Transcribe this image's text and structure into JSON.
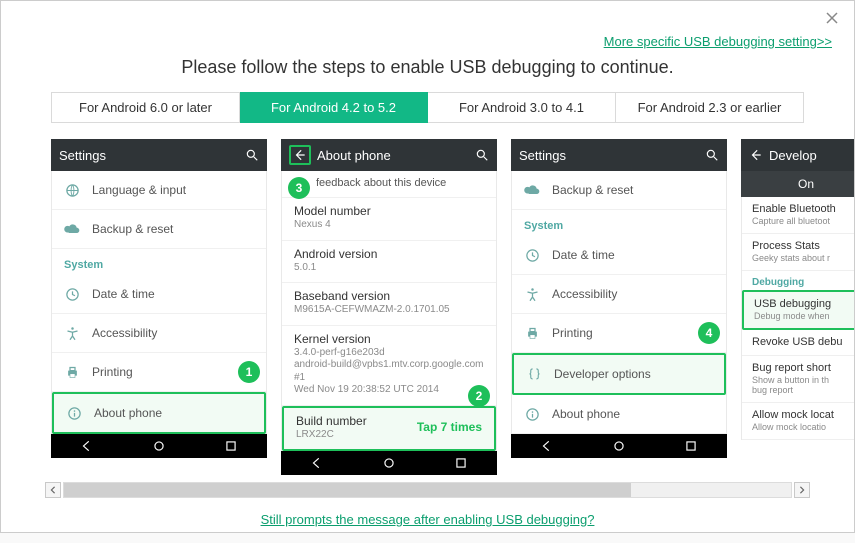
{
  "header": {
    "more_link": "More specific USB debugging setting>>",
    "title": "Please follow the steps to enable USB debugging to continue."
  },
  "tabs": [
    {
      "label": "For Android 6.0 or later",
      "active": false
    },
    {
      "label": "For Android 4.2 to 5.2",
      "active": true
    },
    {
      "label": "For Android 3.0 to 4.1",
      "active": false
    },
    {
      "label": "For Android 2.3 or earlier",
      "active": false
    }
  ],
  "shots": {
    "s1": {
      "appbar_title": "Settings",
      "rows": {
        "lang": "Language & input",
        "backup": "Backup & reset",
        "section": "System",
        "date": "Date & time",
        "access": "Accessibility",
        "print": "Printing",
        "about": "About phone"
      },
      "badge": "1"
    },
    "s2": {
      "appbar_title": "About phone",
      "feedback": "feedback about this device",
      "props": {
        "model_k": "Model number",
        "model_v": "Nexus 4",
        "and_k": "Android version",
        "and_v": "5.0.1",
        "base_k": "Baseband version",
        "base_v": "M9615A-CEFWMAZM-2.0.1701.05",
        "kern_k": "Kernel version",
        "kern_v": "3.4.0-perf-g16e203d\nandroid-build@vpbs1.mtv.corp.google.com #1\nWed Nov 19 20:38:52 UTC 2014",
        "build_k": "Build number",
        "build_v": "LRX22C"
      },
      "tap": "Tap 7 times",
      "badge_back": "3",
      "badge_build": "2"
    },
    "s3": {
      "appbar_title": "Settings",
      "rows": {
        "backup": "Backup & reset",
        "section": "System",
        "date": "Date & time",
        "access": "Accessibility",
        "print": "Printing",
        "dev": "Developer options",
        "about": "About phone"
      },
      "badge": "4"
    },
    "s4": {
      "appbar_title": "Develop",
      "on": "On",
      "rows": {
        "bt_k": "Enable Bluetooth",
        "bt_v": "Capture all bluetoot",
        "ps_k": "Process Stats",
        "ps_v": "Geeky stats about r",
        "section": "Debugging",
        "usb_k": "USB debugging",
        "usb_v": "Debug mode when",
        "rev_k": "Revoke USB debu",
        "bug_k": "Bug report short",
        "bug_v": "Show a button in th\nbug report",
        "mock_k": "Allow mock locat",
        "mock_v": "Allow mock locatio"
      }
    }
  },
  "footer": {
    "prompt_link": "Still prompts the message after enabling USB debugging?"
  }
}
